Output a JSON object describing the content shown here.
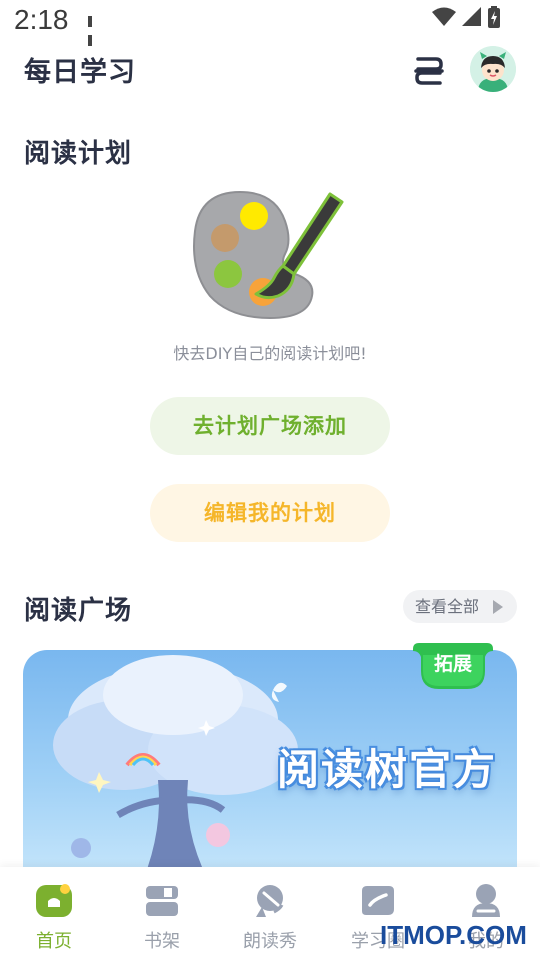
{
  "status_bar": {
    "time": "2:18"
  },
  "header": {
    "title": "每日学习",
    "icons": [
      "scan-icon",
      "avatar"
    ]
  },
  "plan": {
    "title": "阅读计划",
    "empty_text": "快去DIY自己的阅读计划吧!",
    "add_button": "去计划广场添加",
    "edit_button": "编辑我的计划",
    "icon": "palette-icon"
  },
  "square": {
    "title": "阅读广场",
    "view_all": "查看全部",
    "banner": {
      "title": "阅读树官方",
      "badge": "拓展"
    }
  },
  "nav": {
    "items": [
      {
        "label": "首页",
        "icon": "home-icon",
        "active": true
      },
      {
        "label": "书架",
        "icon": "bookshelf-icon",
        "active": false
      },
      {
        "label": "朗读秀",
        "icon": "read-aloud-icon",
        "active": false
      },
      {
        "label": "学习圈",
        "icon": "study-circle-icon",
        "active": false
      },
      {
        "label": "我的",
        "icon": "profile-icon",
        "active": false
      }
    ]
  },
  "watermark": "ITMOP.COM",
  "colors": {
    "accent_green": "#7cb02f",
    "accent_yellow": "#f5b62a",
    "text_dark": "#2b3145"
  }
}
